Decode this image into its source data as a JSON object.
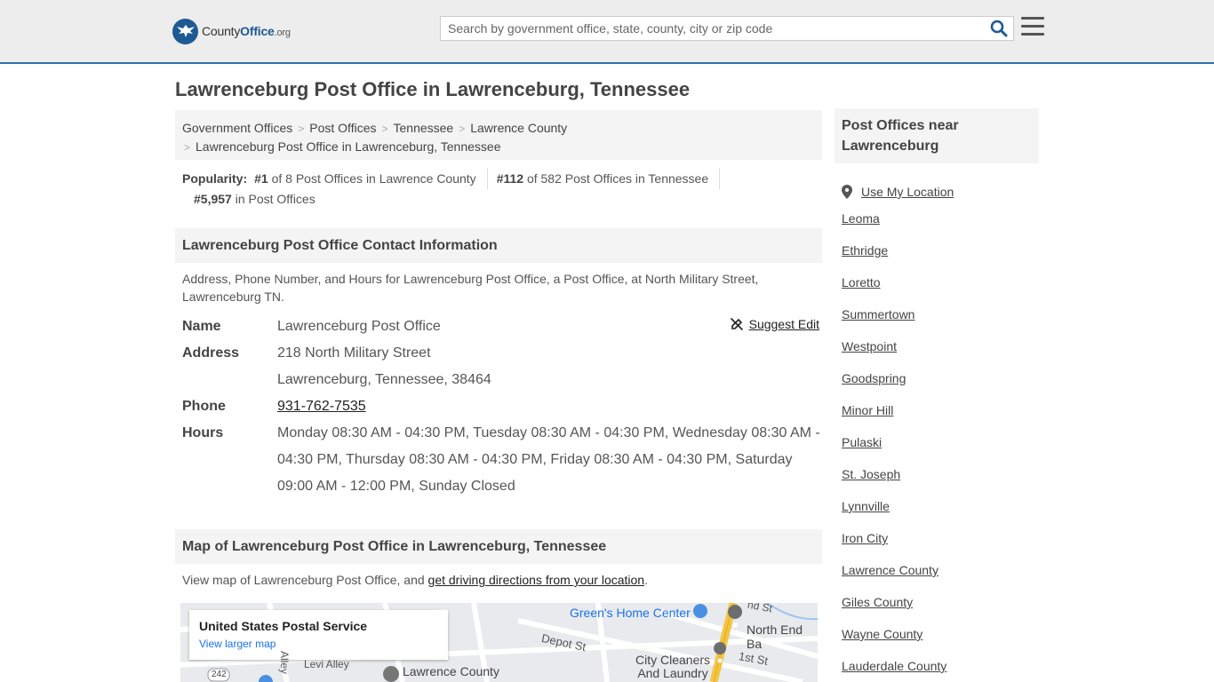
{
  "header": {
    "logo_prefix": "County",
    "logo_bold": "Office",
    "logo_suffix": ".org",
    "search_placeholder": "Search by government office, state, county, city or zip code"
  },
  "page_title": "Lawrenceburg Post Office in Lawrenceburg, Tennessee",
  "breadcrumb": {
    "items": [
      "Government Offices",
      "Post Offices",
      "Tennessee",
      "Lawrence County",
      "Lawrenceburg Post Office in Lawrenceburg, Tennessee"
    ]
  },
  "popularity": {
    "label": "Popularity:",
    "rank1": "#1",
    "rank1_text": "of 8 Post Offices in Lawrence County",
    "rank2": "#112",
    "rank2_text": "of 582 Post Offices in Tennessee",
    "rank3": "#5,957",
    "rank3_text": "in Post Offices"
  },
  "contact": {
    "heading": "Lawrenceburg Post Office Contact Information",
    "description": "Address, Phone Number, and Hours for Lawrenceburg Post Office, a Post Office, at North Military Street, Lawrenceburg TN.",
    "suggest_edit": "Suggest Edit",
    "name_label": "Name",
    "name": "Lawrenceburg Post Office",
    "address_label": "Address",
    "address1": "218 North Military Street",
    "address2": "Lawrenceburg, Tennessee, 38464",
    "phone_label": "Phone",
    "phone": "931-762-7535",
    "hours_label": "Hours",
    "hours": "Monday 08:30 AM - 04:30 PM, Tuesday 08:30 AM - 04:30 PM, Wednesday 08:30 AM - 04:30 PM, Thursday 08:30 AM - 04:30 PM, Friday 08:30 AM - 04:30 PM, Saturday 09:00 AM - 12:00 PM, Sunday Closed"
  },
  "map": {
    "heading": "Map of Lawrenceburg Post Office in Lawrenceburg, Tennessee",
    "desc_prefix": "View map of Lawrenceburg Post Office, and ",
    "desc_link": "get driving directions from your location",
    "desc_suffix": ".",
    "card_title": "United States Postal Service",
    "card_link": "View larger map",
    "labels": {
      "greens": "Green's Home Center",
      "north_end": "North End Ba",
      "depot": "Depot St",
      "first": "1st St",
      "levi": "Levi Alley",
      "alley": "Alley",
      "city_cleaners_1": "City Cleaners",
      "city_cleaners_2": "And Laundry",
      "lawrence_county": "Lawrence County",
      "nd_st": "nd St",
      "route": "242"
    }
  },
  "sidebar": {
    "heading": "Post Offices near Lawrenceburg",
    "use_location": "Use My Location",
    "items": [
      "Leoma",
      "Ethridge",
      "Loretto",
      "Summertown",
      "Westpoint",
      "Goodspring",
      "Minor Hill",
      "Pulaski",
      "St. Joseph",
      "Lynnville",
      "Iron City",
      "Lawrence County",
      "Giles County",
      "Wayne County",
      "Lauderdale County"
    ]
  },
  "colors": {
    "brand": "#1e5a94",
    "header_bg": "#ededed",
    "panel_bg": "#f4f4f4"
  }
}
